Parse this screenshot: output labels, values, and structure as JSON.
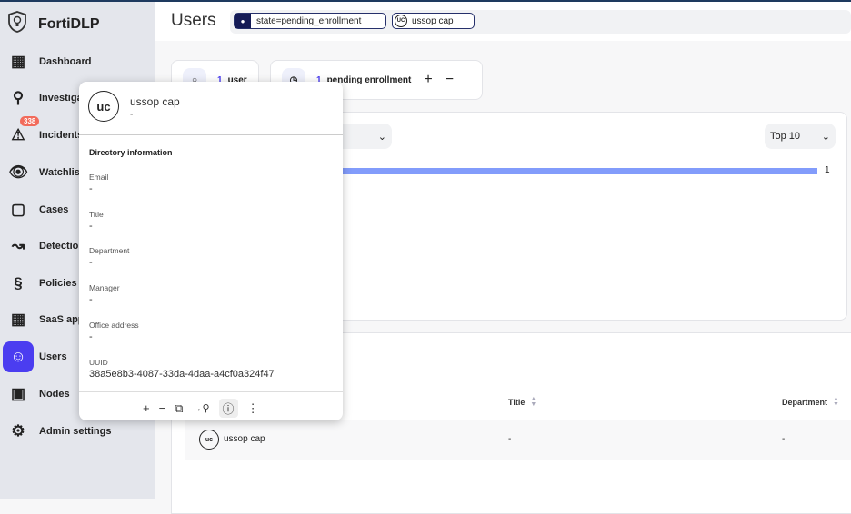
{
  "brand": "FortiDLP",
  "nav": [
    {
      "label": "Dashboard",
      "icon": "dashboard-icon"
    },
    {
      "label": "Investiga",
      "icon": "search-icon"
    },
    {
      "label": "Incidents",
      "icon": "warning-icon",
      "badge": "338"
    },
    {
      "label": "Watchlist",
      "icon": "eye-icon"
    },
    {
      "label": "Cases",
      "icon": "briefcase-icon"
    },
    {
      "label": "Detection",
      "icon": "trend-icon"
    },
    {
      "label": "Policies",
      "icon": "policy-icon"
    },
    {
      "label": "SaaS app",
      "icon": "apps-icon"
    },
    {
      "label": "Users",
      "icon": "user-icon",
      "active": true
    },
    {
      "label": "Nodes",
      "icon": "laptop-icon"
    },
    {
      "label": "Admin settings",
      "icon": "gear-icon"
    }
  ],
  "header": {
    "title": "Users",
    "filters": [
      "state=pending_enrollment",
      "ussop cap"
    ],
    "filter_avatar": "UC"
  },
  "stats": {
    "users_count": "1",
    "users_label": "user",
    "pending_count": "1",
    "pending_label": "pending enrollment"
  },
  "chart": {
    "top_select": "Top 10",
    "bar_value": "1"
  },
  "chart_data": {
    "type": "bar",
    "categories": [
      "ussop cap"
    ],
    "values": [
      1
    ],
    "title": "",
    "xlabel": "",
    "ylabel": ""
  },
  "table": {
    "headers": [
      "Title",
      "Department"
    ],
    "rows": [
      {
        "initials": "uc",
        "name": "ussop cap",
        "title": "-",
        "department": "-"
      }
    ]
  },
  "popup": {
    "initials": "uc",
    "name": "ussop cap",
    "subtitle": "-",
    "section": "Directory information",
    "fields": [
      {
        "label": "Email",
        "value": "-"
      },
      {
        "label": "Title",
        "value": "-"
      },
      {
        "label": "Department",
        "value": "-"
      },
      {
        "label": "Manager",
        "value": "-"
      },
      {
        "label": "Office address",
        "value": "-"
      },
      {
        "label": "UUID",
        "value": "38a5e8b3-4087-33da-4daa-a4cf0a324f47"
      }
    ]
  },
  "colors": {
    "accent": "#4b3df0",
    "bar": "#829cfb",
    "badge": "#f26b5b"
  }
}
